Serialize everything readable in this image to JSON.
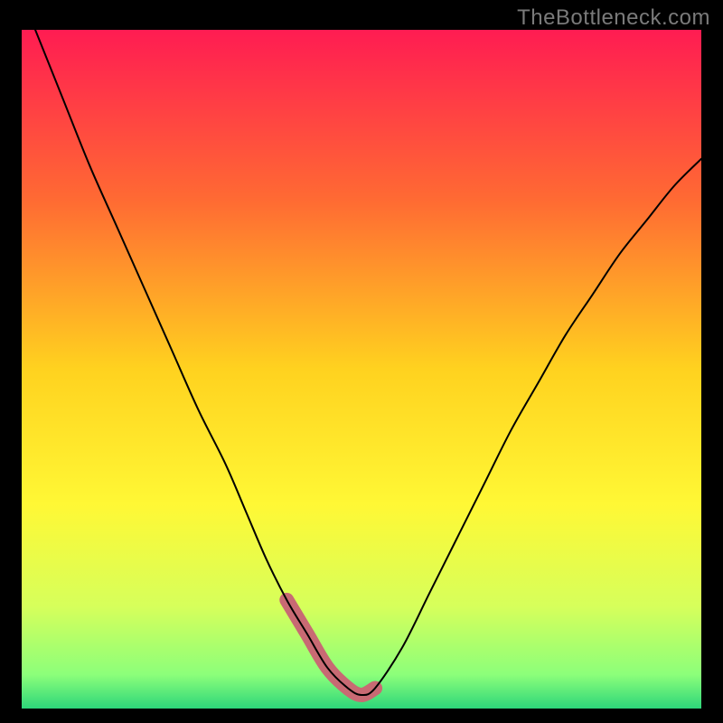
{
  "watermark": {
    "text": "TheBottleneck.com"
  },
  "chart_data": {
    "type": "line",
    "title": "",
    "xlabel": "",
    "ylabel": "",
    "xlim": [
      0,
      100
    ],
    "ylim": [
      0,
      100
    ],
    "series": [
      {
        "name": "bottleneck-curve",
        "x": [
          2,
          6,
          10,
          14,
          18,
          22,
          26,
          30,
          33,
          36,
          39,
          42,
          45,
          48,
          50,
          52,
          56,
          60,
          64,
          68,
          72,
          76,
          80,
          84,
          88,
          92,
          96,
          100
        ],
        "y": [
          100,
          90,
          80,
          71,
          62,
          53,
          44,
          36,
          29,
          22,
          16,
          11,
          6,
          3,
          2,
          3,
          9,
          17,
          25,
          33,
          41,
          48,
          55,
          61,
          67,
          72,
          77,
          81
        ]
      }
    ],
    "highlight_range_x": [
      37,
      55
    ],
    "gradient_stops": [
      {
        "offset": 0.0,
        "color": "#ff1c52"
      },
      {
        "offset": 0.25,
        "color": "#ff6a33"
      },
      {
        "offset": 0.5,
        "color": "#ffd21f"
      },
      {
        "offset": 0.7,
        "color": "#fff835"
      },
      {
        "offset": 0.85,
        "color": "#d6ff5b"
      },
      {
        "offset": 0.95,
        "color": "#8cff7a"
      },
      {
        "offset": 1.0,
        "color": "#2dd67a"
      }
    ]
  }
}
